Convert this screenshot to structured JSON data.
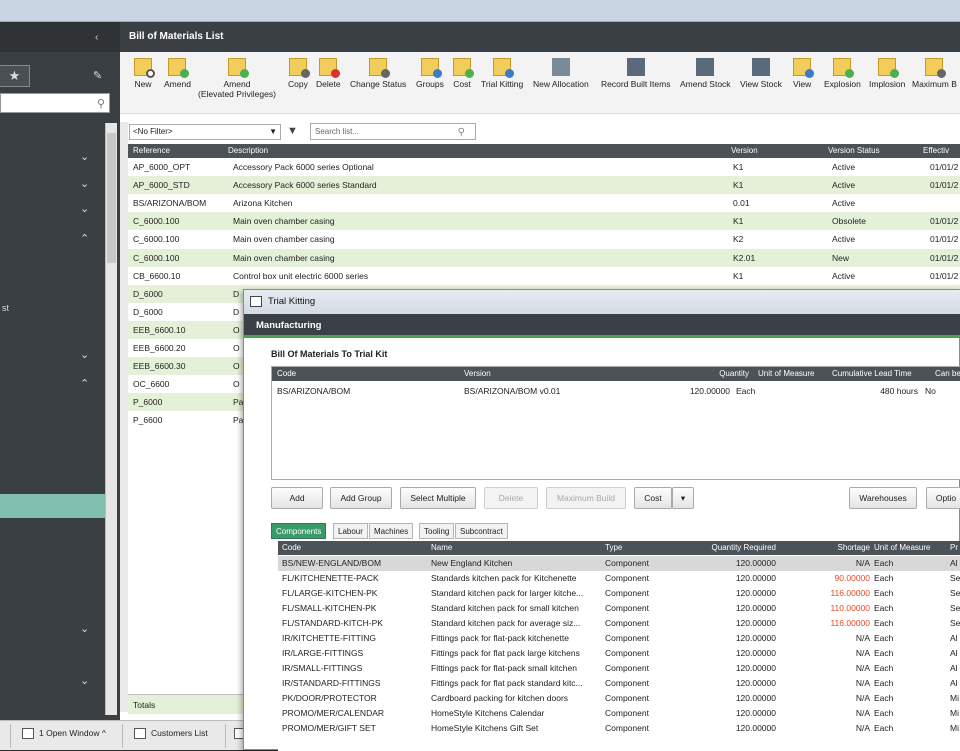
{
  "sidebar": {
    "partial_label": "st"
  },
  "main": {
    "title": "Bill of Materials List",
    "toolbar": [
      {
        "label": "New",
        "icon": "new-icon"
      },
      {
        "label": "Amend",
        "icon": "amend-icon"
      },
      {
        "label": "Amend\n(Elevated Privileges)",
        "icon": "amend-elevated-icon"
      },
      {
        "label": "Copy",
        "icon": "copy-icon"
      },
      {
        "label": "Delete",
        "icon": "delete-icon"
      },
      {
        "label": "Change Status",
        "icon": "change-status-icon"
      },
      {
        "label": "Groups",
        "icon": "groups-icon"
      },
      {
        "label": "Cost",
        "icon": "cost-icon"
      },
      {
        "label": "Trial Kitting",
        "icon": "trial-kitting-icon"
      },
      {
        "label": "New Allocation",
        "icon": "new-allocation-icon"
      },
      {
        "label": "Record Built Items",
        "icon": "record-built-items-icon"
      },
      {
        "label": "Amend Stock",
        "icon": "amend-stock-icon"
      },
      {
        "label": "View Stock",
        "icon": "view-stock-icon"
      },
      {
        "label": "View",
        "icon": "view-icon"
      },
      {
        "label": "Explosion",
        "icon": "explosion-icon"
      },
      {
        "label": "Implosion",
        "icon": "implosion-icon"
      },
      {
        "label": "Maximum B",
        "icon": "maximum-build-icon"
      }
    ],
    "filter": {
      "value": "<No Filter>",
      "search_placeholder": "Search list..."
    },
    "columns": [
      "Reference",
      "Description",
      "Version",
      "Version Status",
      "Effectiv"
    ],
    "rows": [
      {
        "ref": "AP_6000_OPT",
        "desc": "Accessory Pack 6000 series Optional",
        "ver": "K1",
        "status": "Active",
        "eff": "01/01/2"
      },
      {
        "ref": "AP_6000_STD",
        "desc": "Accessory Pack 6000 series Standard",
        "ver": "K1",
        "status": "Active",
        "eff": "01/01/2"
      },
      {
        "ref": "BS/ARIZONA/BOM",
        "desc": "Arizona Kitchen",
        "ver": "0.01",
        "status": "Active",
        "eff": ""
      },
      {
        "ref": "C_6000.100",
        "desc": "Main oven chamber casing",
        "ver": "K1",
        "status": "Obsolete",
        "eff": "01/01/2"
      },
      {
        "ref": "C_6000.100",
        "desc": "Main oven chamber casing",
        "ver": "K2",
        "status": "Active",
        "eff": "01/01/2"
      },
      {
        "ref": "C_6000.100",
        "desc": "Main oven chamber casing",
        "ver": "K2.01",
        "status": "New",
        "eff": "01/01/2"
      },
      {
        "ref": "CB_6600.10",
        "desc": "Control box unit electric 6000 series",
        "ver": "K1",
        "status": "Active",
        "eff": "01/01/2"
      },
      {
        "ref": "D_6000",
        "desc": "D",
        "ver": "",
        "status": "",
        "eff": ""
      },
      {
        "ref": "D_6000",
        "desc": "D",
        "ver": "",
        "status": "",
        "eff": ""
      },
      {
        "ref": "EEB_6600.10",
        "desc": "O",
        "ver": "",
        "status": "",
        "eff": ""
      },
      {
        "ref": "EEB_6600.20",
        "desc": "O",
        "ver": "",
        "status": "",
        "eff": ""
      },
      {
        "ref": "EEB_6600.30",
        "desc": "O",
        "ver": "",
        "status": "",
        "eff": ""
      },
      {
        "ref": "OC_6600",
        "desc": "O",
        "ver": "",
        "status": "",
        "eff": ""
      },
      {
        "ref": "P_6000",
        "desc": "Pa",
        "ver": "",
        "status": "",
        "eff": ""
      },
      {
        "ref": "P_6600",
        "desc": "Pa",
        "ver": "",
        "status": "",
        "eff": ""
      }
    ],
    "totals_label": "Totals"
  },
  "taskbar": {
    "open_windows": "1 Open Window ^",
    "customers_list": "Customers List"
  },
  "trial_kitting": {
    "title": "Trial Kitting",
    "header": "Manufacturing",
    "section_title": "Bill Of Materials To Trial Kit",
    "bom_columns": [
      "Code",
      "Version",
      "Quantity",
      "Unit of Measure",
      "Cumulative Lead Time",
      "Can be b"
    ],
    "bom_row": {
      "code": "BS/ARIZONA/BOM",
      "version": "BS/ARIZONA/BOM v0.01",
      "qty": "120.00000",
      "uom": "Each",
      "lead": "480 hours",
      "can": "No"
    },
    "buttons": {
      "add": "Add",
      "add_group": "Add Group",
      "select_multiple": "Select Multiple",
      "delete": "Delete",
      "maximum_build": "Maximum Build",
      "cost": "Cost",
      "warehouses": "Warehouses",
      "options": "Optio"
    },
    "tabs": [
      "Components",
      "Labour",
      "Machines",
      "Tooling",
      "Subcontract"
    ],
    "comp_columns": [
      "Code",
      "Name",
      "Type",
      "Quantity Required",
      "Shortage",
      "Unit of Measure",
      "Pr"
    ],
    "components": [
      {
        "code": "BS/NEW-ENGLAND/BOM",
        "name": "New England Kitchen",
        "type": "Component",
        "qty": "120.00000",
        "short": "N/A",
        "uom": "Each",
        "pr": "Al",
        "warn": false
      },
      {
        "code": "FL/KITCHENETTE-PACK",
        "name": "Standards kitchen pack for Kitchenette",
        "type": "Component",
        "qty": "120.00000",
        "short": "90.00000",
        "uom": "Each",
        "pr": "Se",
        "warn": true
      },
      {
        "code": "FL/LARGE-KITCHEN-PK",
        "name": "Standard kitchen pack for larger kitche...",
        "type": "Component",
        "qty": "120.00000",
        "short": "116.00000",
        "uom": "Each",
        "pr": "Se",
        "warn": true
      },
      {
        "code": "FL/SMALL-KITCHEN-PK",
        "name": "Standard kitchen pack for small kitchen",
        "type": "Component",
        "qty": "120.00000",
        "short": "110.00000",
        "uom": "Each",
        "pr": "Se",
        "warn": true
      },
      {
        "code": "FL/STANDARD-KITCH-PK",
        "name": "Standard kitchen pack for average siz...",
        "type": "Component",
        "qty": "120.00000",
        "short": "116.00000",
        "uom": "Each",
        "pr": "Se",
        "warn": true
      },
      {
        "code": "IR/KITCHETTE-FITTING",
        "name": "Fittings pack for flat-pack kitchenette",
        "type": "Component",
        "qty": "120.00000",
        "short": "N/A",
        "uom": "Each",
        "pr": "Al",
        "warn": false
      },
      {
        "code": "IR/LARGE-FITTINGS",
        "name": "Fittings pack for flat pack large kitchens",
        "type": "Component",
        "qty": "120.00000",
        "short": "N/A",
        "uom": "Each",
        "pr": "Al",
        "warn": false
      },
      {
        "code": "IR/SMALL-FITTINGS",
        "name": "Fittings pack for flat-pack small kitchen",
        "type": "Component",
        "qty": "120.00000",
        "short": "N/A",
        "uom": "Each",
        "pr": "Al",
        "warn": false
      },
      {
        "code": "IR/STANDARD-FITTINGS",
        "name": "Fittings pack for flat pack standard kitc...",
        "type": "Component",
        "qty": "120.00000",
        "short": "N/A",
        "uom": "Each",
        "pr": "Al",
        "warn": false
      },
      {
        "code": "PK/DOOR/PROTECTOR",
        "name": "Cardboard packing for kitchen doors",
        "type": "Component",
        "qty": "120.00000",
        "short": "N/A",
        "uom": "Each",
        "pr": "Mi",
        "warn": false
      },
      {
        "code": "PROMO/MER/CALENDAR",
        "name": "HomeStyle Kitchens Calendar",
        "type": "Component",
        "qty": "120.00000",
        "short": "N/A",
        "uom": "Each",
        "pr": "Mi",
        "warn": false
      },
      {
        "code": "PROMO/MER/GIFT SET",
        "name": "HomeStyle Kitchens Gift Set",
        "type": "Component",
        "qty": "120.00000",
        "short": "N/A",
        "uom": "Each",
        "pr": "Mi",
        "warn": false
      }
    ],
    "colors": {
      "accent": "#49a354",
      "warning": "#e04a2a",
      "header_bg": "#3b4046"
    }
  }
}
